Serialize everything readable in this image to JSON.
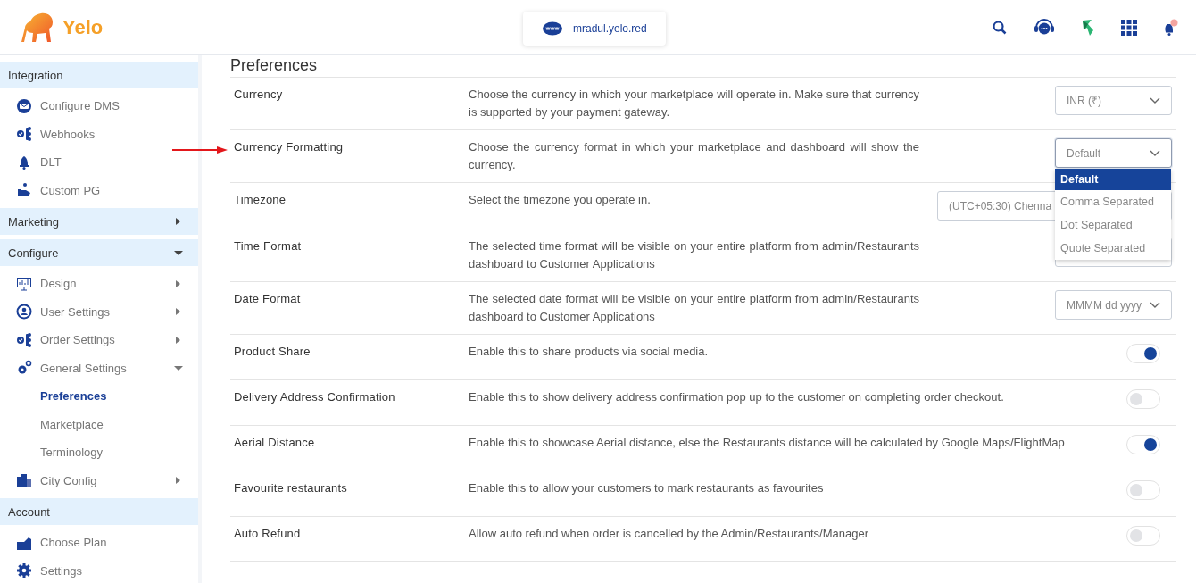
{
  "header": {
    "logo": "Yelo",
    "domain": "mradul.yelo.red"
  },
  "sidebar": {
    "sections": [
      {
        "title": "Integration",
        "items": [
          {
            "label": "Configure DMS",
            "selected": false
          },
          {
            "label": "Webhooks",
            "selected": false
          },
          {
            "label": "DLT",
            "selected": false
          },
          {
            "label": "Custom PG",
            "selected": false
          }
        ]
      },
      {
        "title": "Marketing",
        "expanded": false
      },
      {
        "title": "Configure",
        "expanded": true,
        "items": [
          {
            "label": "Design",
            "selected": false,
            "expanded": false
          },
          {
            "label": "User Settings",
            "selected": false,
            "expanded": false
          },
          {
            "label": "Order Settings",
            "selected": false,
            "expanded": false
          },
          {
            "label": "General Settings",
            "selected": false,
            "expanded": true,
            "children": [
              {
                "label": "Preferences",
                "selected": true
              },
              {
                "label": "Marketplace",
                "selected": false
              },
              {
                "label": "Terminology",
                "selected": false
              }
            ]
          },
          {
            "label": "City Config",
            "selected": false,
            "expanded": false
          }
        ]
      },
      {
        "title": "Account",
        "items": [
          {
            "label": "Choose Plan",
            "selected": false
          },
          {
            "label": "Settings",
            "selected": false
          }
        ]
      }
    ]
  },
  "content": {
    "title": "Preferences",
    "rows": [
      {
        "label": "Currency",
        "description": "Choose the currency in which your marketplace will operate in. Make sure that currency is supported by your payment gateway.",
        "control": {
          "kind": "select",
          "value": "INR (₹)"
        }
      },
      {
        "label": "Currency Formatting",
        "description": "Choose the currency format in which your marketplace and dashboard will show the currency.",
        "control": {
          "kind": "select",
          "value": "Default",
          "expanded": true,
          "options": [
            {
              "label": "Default",
              "selected": true
            },
            {
              "label": "Comma Separated",
              "selected": false
            },
            {
              "label": "Dot Separated",
              "selected": false
            },
            {
              "label": "Quote Separated",
              "selected": false
            }
          ]
        }
      },
      {
        "label": "Timezone",
        "description": "Select the timezone you operate in.",
        "control": {
          "kind": "select",
          "value": "(UTC+05:30) Chenna"
        }
      },
      {
        "label": "Time Format",
        "description": "The selected time format will be visible on your entire platform from admin/Restaurants dashboard to Customer Applications",
        "control": {
          "kind": "select"
        }
      },
      {
        "label": "Date Format",
        "description": "The selected date format will be visible on your entire platform from admin/Restaurants dashboard to Customer Applications",
        "control": {
          "kind": "select",
          "value": "MMMM dd yyyy"
        }
      },
      {
        "label": "Product Share",
        "description": "Enable this to share products via social media.",
        "control": {
          "kind": "toggle",
          "on": true
        }
      },
      {
        "label": "Delivery Address Confirmation",
        "description": "Enable this to show delivery address confirmation pop up to the customer on completing order checkout.",
        "control": {
          "kind": "toggle",
          "on": false
        }
      },
      {
        "label": "Aerial Distance",
        "description": "Enable this to showcase Aerial distance, else the Restaurants distance will be calculated by Google Maps/FlightMap",
        "control": {
          "kind": "toggle",
          "on": true
        }
      },
      {
        "label": "Favourite restaurants",
        "description": "Enable this to allow your customers to mark restaurants as favourites",
        "control": {
          "kind": "toggle",
          "on": false
        }
      },
      {
        "label": "Auto Refund",
        "description": "Allow auto refund when order is cancelled by the Admin/Restaurants/Manager",
        "control": {
          "kind": "toggle",
          "on": false
        }
      }
    ]
  }
}
